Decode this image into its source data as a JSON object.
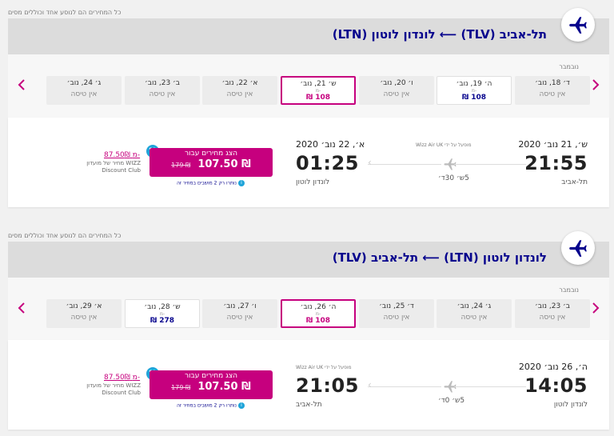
{
  "disclaimer": "כל המחירים הם לנוסע אחד וכוללים מסים",
  "currency_symbol": "₪",
  "fare_marker": "-מ",
  "no_flight": "אין טיסה",
  "colors": {
    "brand_purple": "#06038d",
    "brand_magenta": "#c6007e",
    "discount_blue": "#1fa4d9"
  },
  "flights": [
    {
      "route_title": "תל-אביב (TLV) ⟵ לונדון לוטון (LTN)",
      "month_label": "נובמבר",
      "dates": [
        {
          "label": "ד׳ 18, נוב׳",
          "price": null,
          "state": "normal"
        },
        {
          "label": "ה׳ 19, נוב׳",
          "price": "108",
          "state": "white"
        },
        {
          "label": "ו׳ 20, נוב׳",
          "price": null,
          "state": "normal"
        },
        {
          "label": "ש׳ 21, נוב׳",
          "price": "108",
          "state": "selected"
        },
        {
          "label": "א׳ 22, נוב׳",
          "price": null,
          "state": "normal"
        },
        {
          "label": "ב׳ 23, נוב׳",
          "price": null,
          "state": "normal"
        },
        {
          "label": "ג׳ 24, נוב׳",
          "price": null,
          "state": "normal"
        }
      ],
      "departure": {
        "date": "ש׳, 21 נוב׳ 2020",
        "time": "21:55",
        "city": "תל-אביב"
      },
      "arrival": {
        "date": "א׳, 22 נוב׳ 2020",
        "time": "01:25",
        "city": "לונדון לוטון"
      },
      "operated_by": "מופעל על ידי Wizz Air UK",
      "duration": "5ש׳ 30ד׳",
      "cta_label": "הצג מחירים עבור",
      "price": "107.50",
      "old_price": "179",
      "discount_badge": "%",
      "seats_left": "נותרו רק 2 מושבים במחיר זה",
      "club_price": "87.50",
      "club_text": "מחיר של מועדון WIZZ Discount Club"
    },
    {
      "route_title": "לונדון לוטון (LTN) ⟵ תל-אביב (TLV)",
      "month_label": "נובמבר",
      "dates": [
        {
          "label": "ב׳ 23, נוב׳",
          "price": null,
          "state": "normal"
        },
        {
          "label": "ג׳ 24, נוב׳",
          "price": null,
          "state": "normal"
        },
        {
          "label": "ד׳ 25, נוב׳",
          "price": null,
          "state": "normal"
        },
        {
          "label": "ה׳ 26, נוב׳",
          "price": "108",
          "state": "selected"
        },
        {
          "label": "ו׳ 27, נוב׳",
          "price": null,
          "state": "normal"
        },
        {
          "label": "ש׳ 28, נוב׳",
          "price": "278",
          "state": "white"
        },
        {
          "label": "א׳ 29, נוב׳",
          "price": null,
          "state": "normal"
        }
      ],
      "departure": {
        "date": "ה׳, 26 נוב׳ 2020",
        "time": "14:05",
        "city": "לונדון לוטון"
      },
      "arrival": {
        "date": "",
        "time": "21:05",
        "city": "תל-אביב"
      },
      "operated_by": "מופעל על ידי Wizz Air UK",
      "duration": "5ש׳ 0ד׳",
      "cta_label": "הצג מחירים עבור",
      "price": "107.50",
      "old_price": "179",
      "discount_badge": "%",
      "seats_left": "נותרו רק 2 מושבים במחיר זה",
      "club_price": "87.50",
      "club_text": "מחיר של מועדון WIZZ Discount Club"
    }
  ]
}
